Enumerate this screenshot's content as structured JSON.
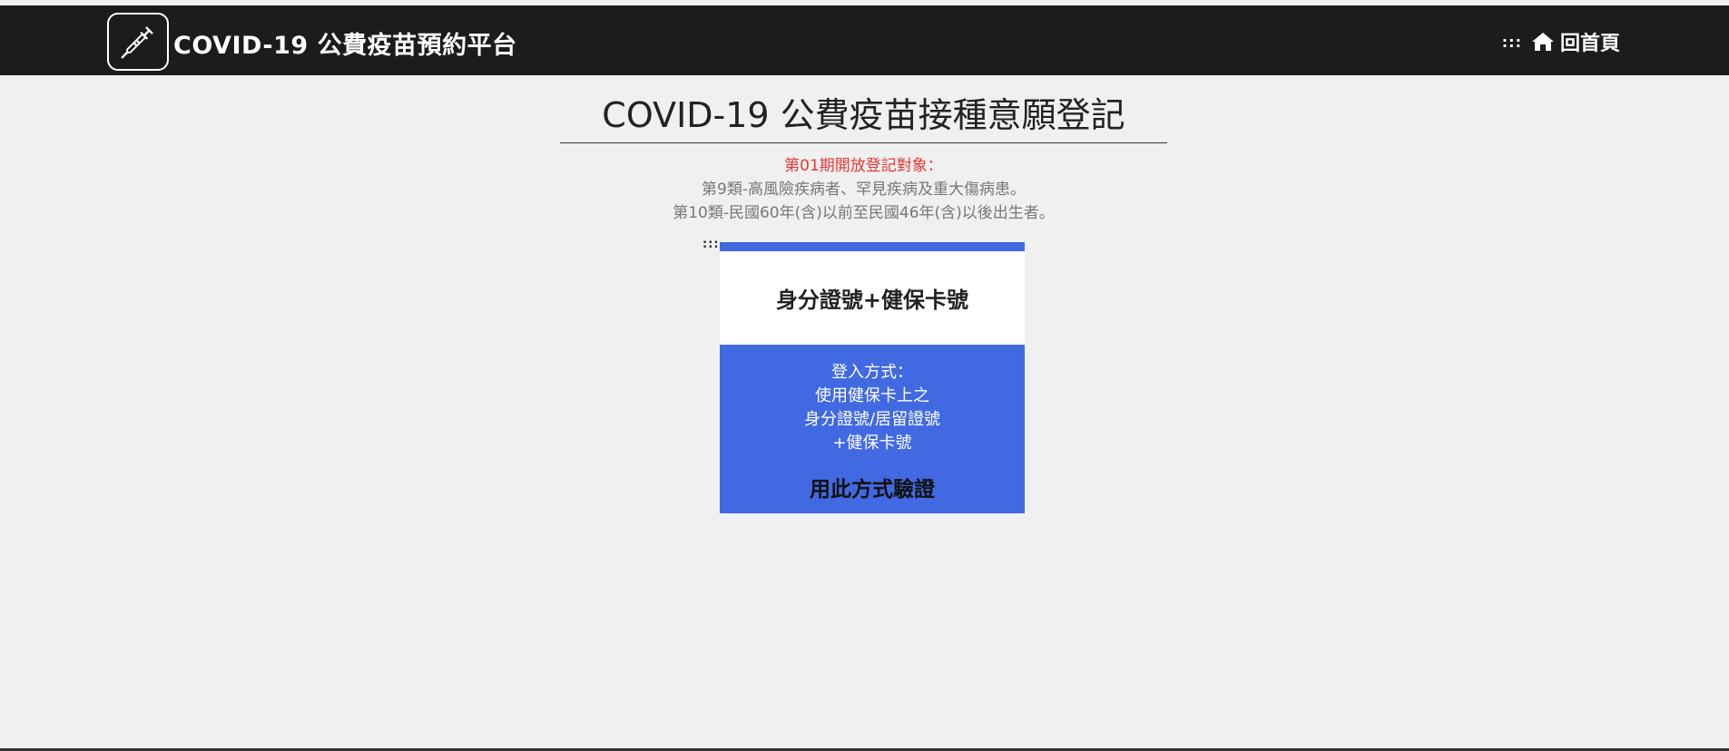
{
  "header": {
    "site_title": "COVID-19 公費疫苗預約平台",
    "logo_icon": "vaccine-calendar-icon",
    "accesskey": ":::",
    "home_label": "回首頁",
    "home_icon": "home-icon"
  },
  "main": {
    "title": "COVID-19 公費疫苗接種意願登記",
    "notice_heading": "第01期開放登記對象：",
    "notice_lines": [
      "第9類-高風險疾病者、罕見疾病及重大傷病患。",
      "第10類-民國60年(含)以前至民國46年(含)以後出生者。"
    ],
    "accesskey": ":::"
  },
  "login_option": {
    "title": "身分證號+健保卡號",
    "description_lines": [
      "登入方式：",
      "使用健保卡上之",
      "身分證號/居留證號",
      "+健保卡號"
    ],
    "action_label": "用此方式驗證"
  },
  "colors": {
    "header_bg": "#1c1c1c",
    "page_bg": "#f0f0f0",
    "accent_blue": "#4169e1",
    "notice_red": "#e53935",
    "notice_gray": "#777777"
  }
}
